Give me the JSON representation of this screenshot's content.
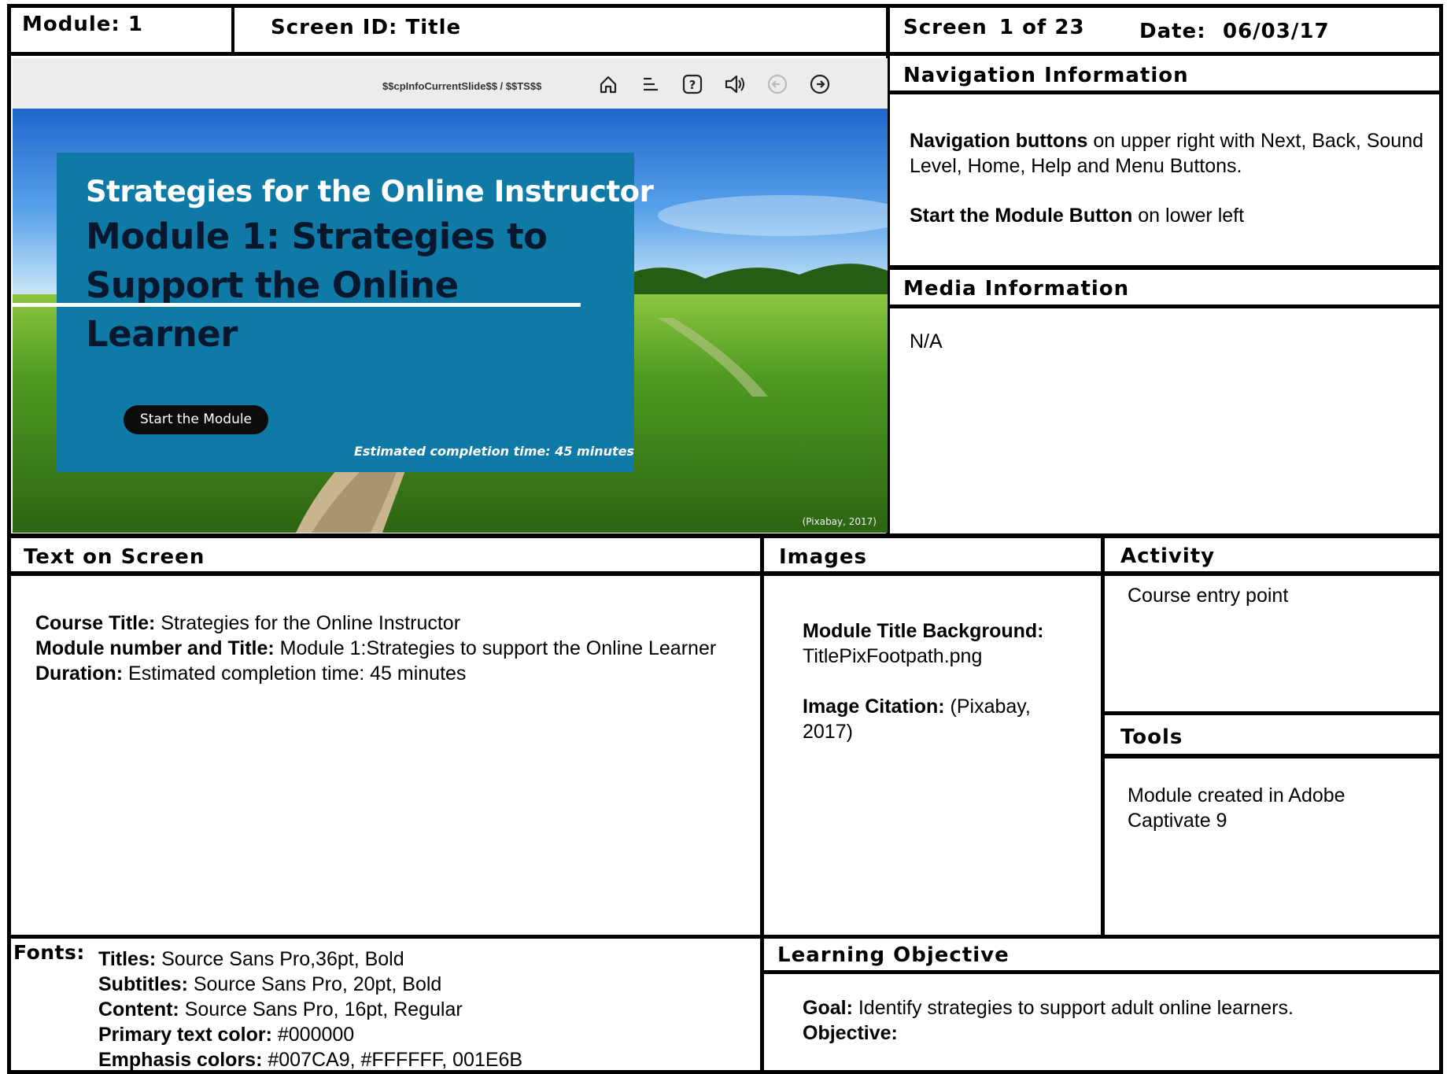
{
  "header": {
    "module": "Module: 1",
    "screen_id": "Screen ID: Title",
    "screen_label": "Screen",
    "screen_num": "1 of 23",
    "date_label": "Date:",
    "date_value": "06/03/17"
  },
  "slide": {
    "counter_text": "$$cpInfoCurrentSlide$$ / $$TS$$",
    "controls": [
      "home-icon",
      "menu-icon",
      "help-icon",
      "sound-icon",
      "back-icon",
      "next-icon"
    ],
    "course_title": "Strategies for the Online Instructor",
    "module_title": "Module 1: Strategies to Support the Online Learner",
    "start_button": "Start the Module",
    "estimated_time": "Estimated completion time: 45 minutes",
    "citation": "(Pixabay, 2017)",
    "colors": {
      "card": "#0f7aa6",
      "module_title": "#07172e",
      "bar": "#ececec"
    }
  },
  "navigation": {
    "heading": "Navigation Information",
    "p1_bold": "Navigation buttons",
    "p1_text": " on upper right with Next, Back, Sound Level, Home, Help and Menu Buttons.",
    "p2_bold": "Start the Module Button",
    "p2_text": " on lower left"
  },
  "media": {
    "heading": "Media Information",
    "text": "N/A"
  },
  "text_on_screen": {
    "heading": "Text on Screen",
    "course_label": "Course Title:",
    "course_value": " Strategies for the Online Instructor",
    "module_label": "Module number and Title:",
    "module_value": " Module 1:Strategies to support the Online Learner",
    "duration_label": "Duration:",
    "duration_value": " Estimated completion time: 45 minutes"
  },
  "images": {
    "heading": "Images",
    "bg_label": "Module Title Background:",
    "bg_value": "TitlePixFootpath.png",
    "cite_label": "Image Citation:",
    "cite_value": " (Pixabay, 2017)"
  },
  "activity": {
    "heading": "Activity",
    "text": "Course entry point"
  },
  "tools": {
    "heading": "Tools",
    "text": "Module created in Adobe Captivate 9"
  },
  "fonts": {
    "heading": "Fonts:",
    "titles_label": "Titles:",
    "titles_value": " Source Sans Pro,36pt, Bold",
    "subtitles_label": "Subtitles:",
    "subtitles_value": " Source Sans Pro, 20pt, Bold",
    "content_label": "Content:",
    "content_value": " Source Sans Pro, 16pt, Regular",
    "primary_label": "Primary text color:",
    "primary_value": " #000000",
    "emphasis_label": "Emphasis colors:",
    "emphasis_value": " #007CA9, #FFFFFF, 001E6B"
  },
  "learning_objective": {
    "heading": "Learning Objective",
    "goal_label": "Goal:",
    "goal_value": " Identify strategies to support adult online learners.",
    "objective_label": "Objective:"
  }
}
